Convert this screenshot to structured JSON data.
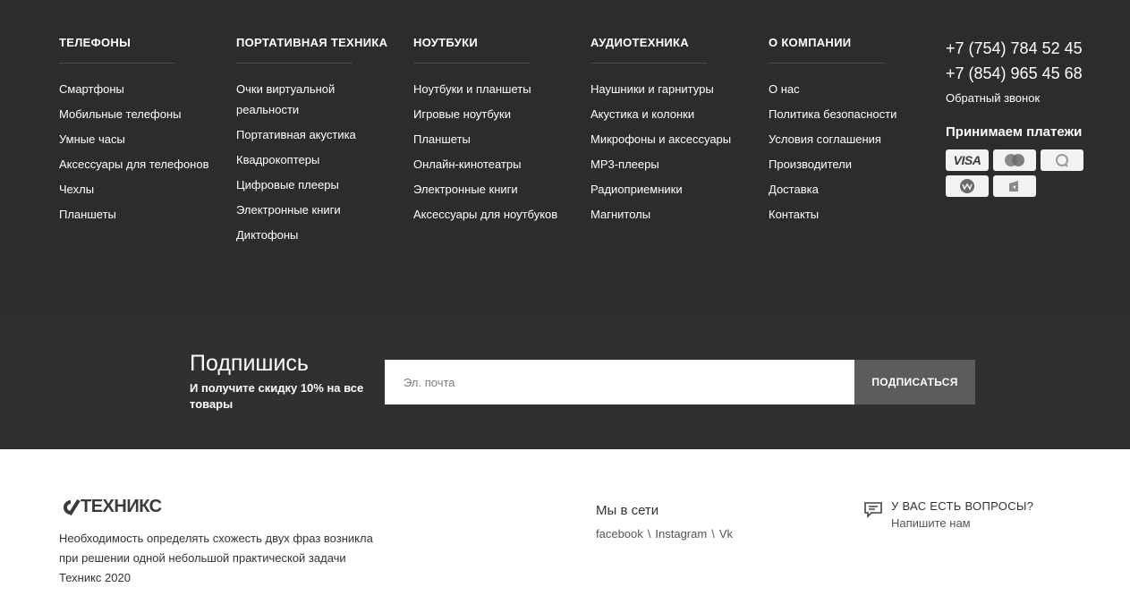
{
  "columns": [
    {
      "title": "ТЕЛЕФОНЫ",
      "items": [
        "Смартфоны",
        "Мобильные телефоны",
        "Умные часы",
        "Аксессуары для телефонов",
        "Чехлы",
        "Планшеты"
      ]
    },
    {
      "title": "ПОРТАТИВНАЯ ТЕХНИКА",
      "items": [
        "Очки виртуальной реальности",
        "Портативная акустика",
        "Квадрокоптеры",
        "Цифровые плееры",
        "Электронные книги",
        "Диктофоны"
      ]
    },
    {
      "title": "НОУТБУКИ",
      "items": [
        "Ноутбуки и планшеты",
        "Игровые ноутбуки",
        "Планшеты",
        "Онлайн-кинотеатры",
        "Электронные книги",
        "Аксессуары для ноутбуков"
      ]
    },
    {
      "title": "АУДИОТЕХНИКА",
      "items": [
        "Наушники и гарнитуры",
        "Акустика и колонки",
        "Микрофоны и аксессуары",
        "MP3-плееры",
        "Радиоприемники",
        "Магнитолы"
      ]
    },
    {
      "title": "О КОМПАНИИ",
      "items": [
        "О нас",
        "Политика безопасности",
        "Условия соглашения",
        "Производители",
        "Доставка",
        "Контакты"
      ]
    }
  ],
  "contacts": {
    "phone1": "+7 (754) 784 52 45",
    "phone2": "+7 (854) 965 45 68",
    "callback": "Обратный звонок",
    "payments_title": "Принимаем платежи",
    "payments": [
      "visa-icon",
      "mastercard-icon",
      "qiwi-icon",
      "webmoney-icon",
      "yandex-money-icon"
    ],
    "visa_label": "VISA"
  },
  "subscribe": {
    "title": "Подпишись",
    "subtitle": "И получите скидку 10% на все товары",
    "placeholder": "Эл. почта",
    "button": "ПОДПИСАТЬСЯ"
  },
  "footer": {
    "logo": "ТЕХНИКС",
    "about_line1": "Необходимость определять схожесть двух фраз возникла",
    "about_line2": "при решении одной небольшой практической задачи",
    "copyright": "Техникс 2020",
    "social_title": "Мы в сети",
    "social_links": [
      "facebook",
      "Instagram",
      "Vk"
    ],
    "social_sep": "\\",
    "question_title": "У ВАС ЕСТЬ ВОПРОСЫ?",
    "question_sub": "Напишите нам"
  },
  "colors": {
    "top_bg": "#2c2c2c",
    "subscribe_bg": "#303030",
    "button_bg": "#5c5c5c"
  }
}
